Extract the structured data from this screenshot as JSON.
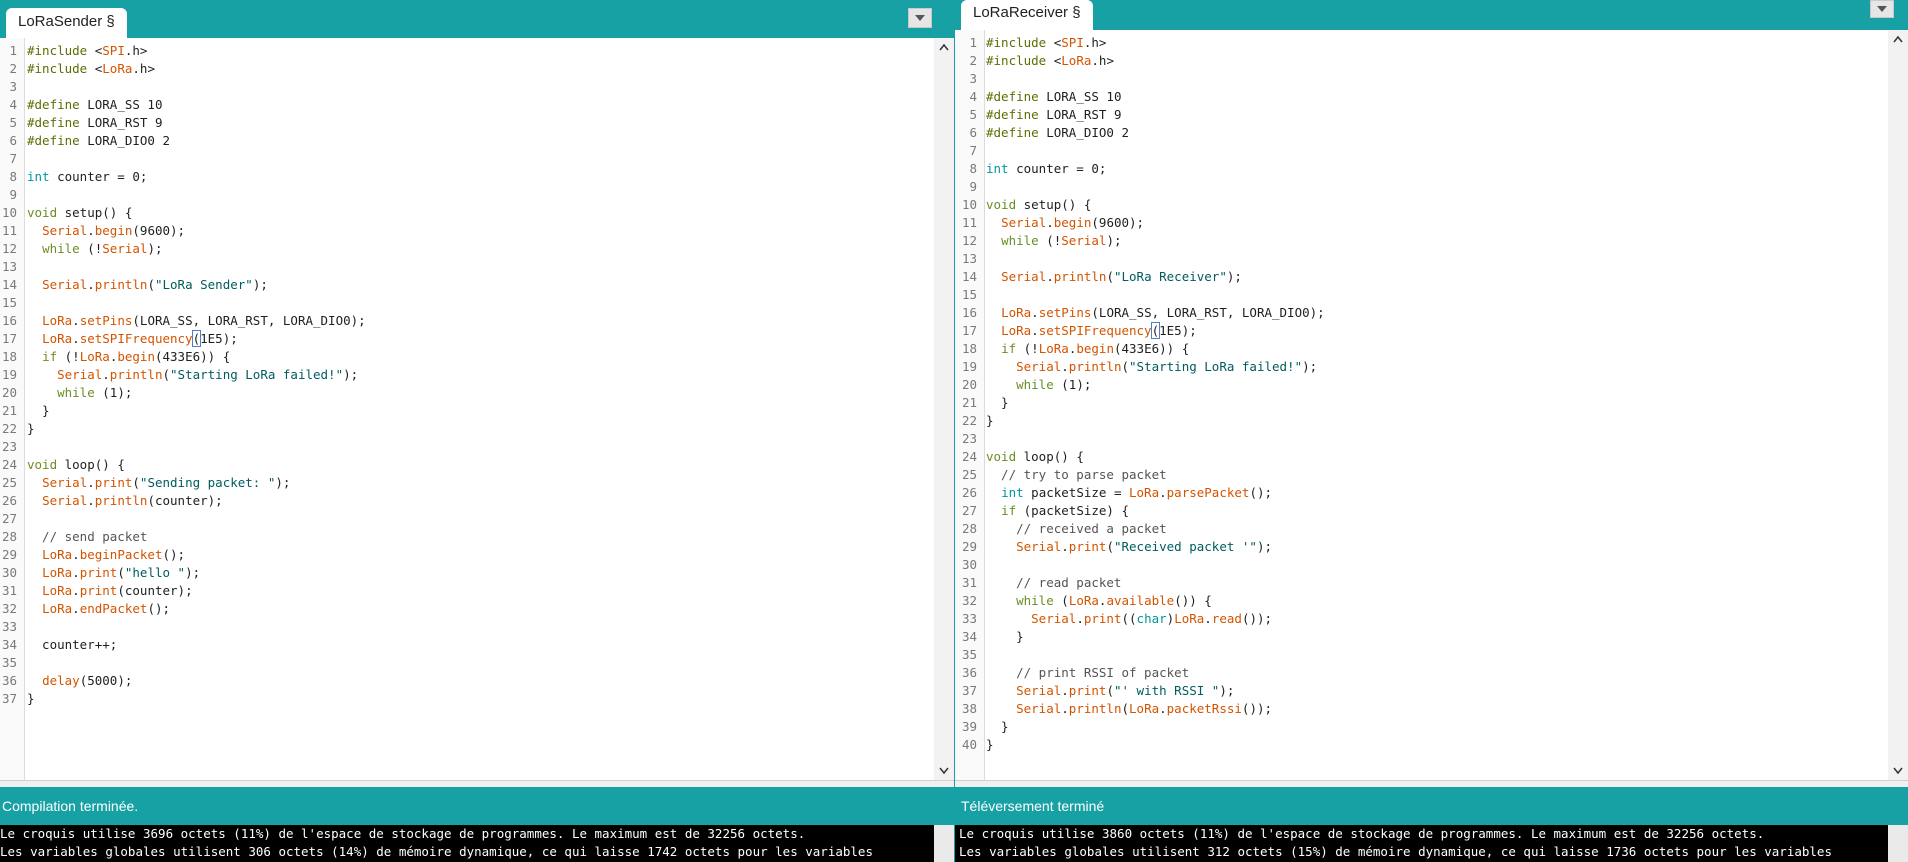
{
  "left": {
    "tab": "LoRaSender §",
    "status": "Compilation terminée.",
    "console": [
      "Le croquis utilise 3696 octets (11%) de l'espace de stockage de programmes. Le maximum est de 32256 octets.",
      "Les variables globales utilisent 306 octets (14%) de mémoire dynamique, ce qui laisse 1742 octets pour les variables"
    ],
    "code": [
      "#include <SPI.h>",
      "#include <LoRa.h>",
      "",
      "#define LORA_SS 10",
      "#define LORA_RST 9",
      "#define LORA_DIO0 2",
      "",
      "int counter = 0;",
      "",
      "void setup() {",
      "  Serial.begin(9600);",
      "  while (!Serial);",
      "",
      "  Serial.println(\"LoRa Sender\");",
      "",
      "  LoRa.setPins(LORA_SS, LORA_RST, LORA_DIO0);",
      "  LoRa.setSPIFrequency(1E5);",
      "  if (!LoRa.begin(433E6)) {",
      "    Serial.println(\"Starting LoRa failed!\");",
      "    while (1);",
      "  }",
      "}",
      "",
      "void loop() {",
      "  Serial.print(\"Sending packet: \");",
      "  Serial.println(counter);",
      "",
      "  // send packet",
      "  LoRa.beginPacket();",
      "  LoRa.print(\"hello \");",
      "  LoRa.print(counter);",
      "  LoRa.endPacket();",
      "",
      "  counter++;",
      "",
      "  delay(5000);",
      "}"
    ]
  },
  "right": {
    "tab": "LoRaReceiver §",
    "status": "Téléversement terminé",
    "console": [
      "Le croquis utilise 3860 octets (11%) de l'espace de stockage de programmes. Le maximum est de 32256 octets.",
      "Les variables globales utilisent 312 octets (15%) de mémoire dynamique, ce qui laisse 1736 octets pour les variables"
    ],
    "code": [
      "#include <SPI.h>",
      "#include <LoRa.h>",
      "",
      "#define LORA_SS 10",
      "#define LORA_RST 9",
      "#define LORA_DIO0 2",
      "",
      "int counter = 0;",
      "",
      "void setup() {",
      "  Serial.begin(9600);",
      "  while (!Serial);",
      "",
      "  Serial.println(\"LoRa Receiver\");",
      "",
      "  LoRa.setPins(LORA_SS, LORA_RST, LORA_DIO0);",
      "  LoRa.setSPIFrequency(1E5);",
      "  if (!LoRa.begin(433E6)) {",
      "    Serial.println(\"Starting LoRa failed!\");",
      "    while (1);",
      "  }",
      "}",
      "",
      "void loop() {",
      "  // try to parse packet",
      "  int packetSize = LoRa.parsePacket();",
      "  if (packetSize) {",
      "    // received a packet",
      "    Serial.print(\"Received packet '\");",
      "",
      "    // read packet",
      "    while (LoRa.available()) {",
      "      Serial.print((char)LoRa.read());",
      "    }",
      "",
      "    // print RSSI of packet",
      "    Serial.print(\"' with RSSI \");",
      "    Serial.println(LoRa.packetRssi());",
      "  }",
      "}"
    ]
  }
}
